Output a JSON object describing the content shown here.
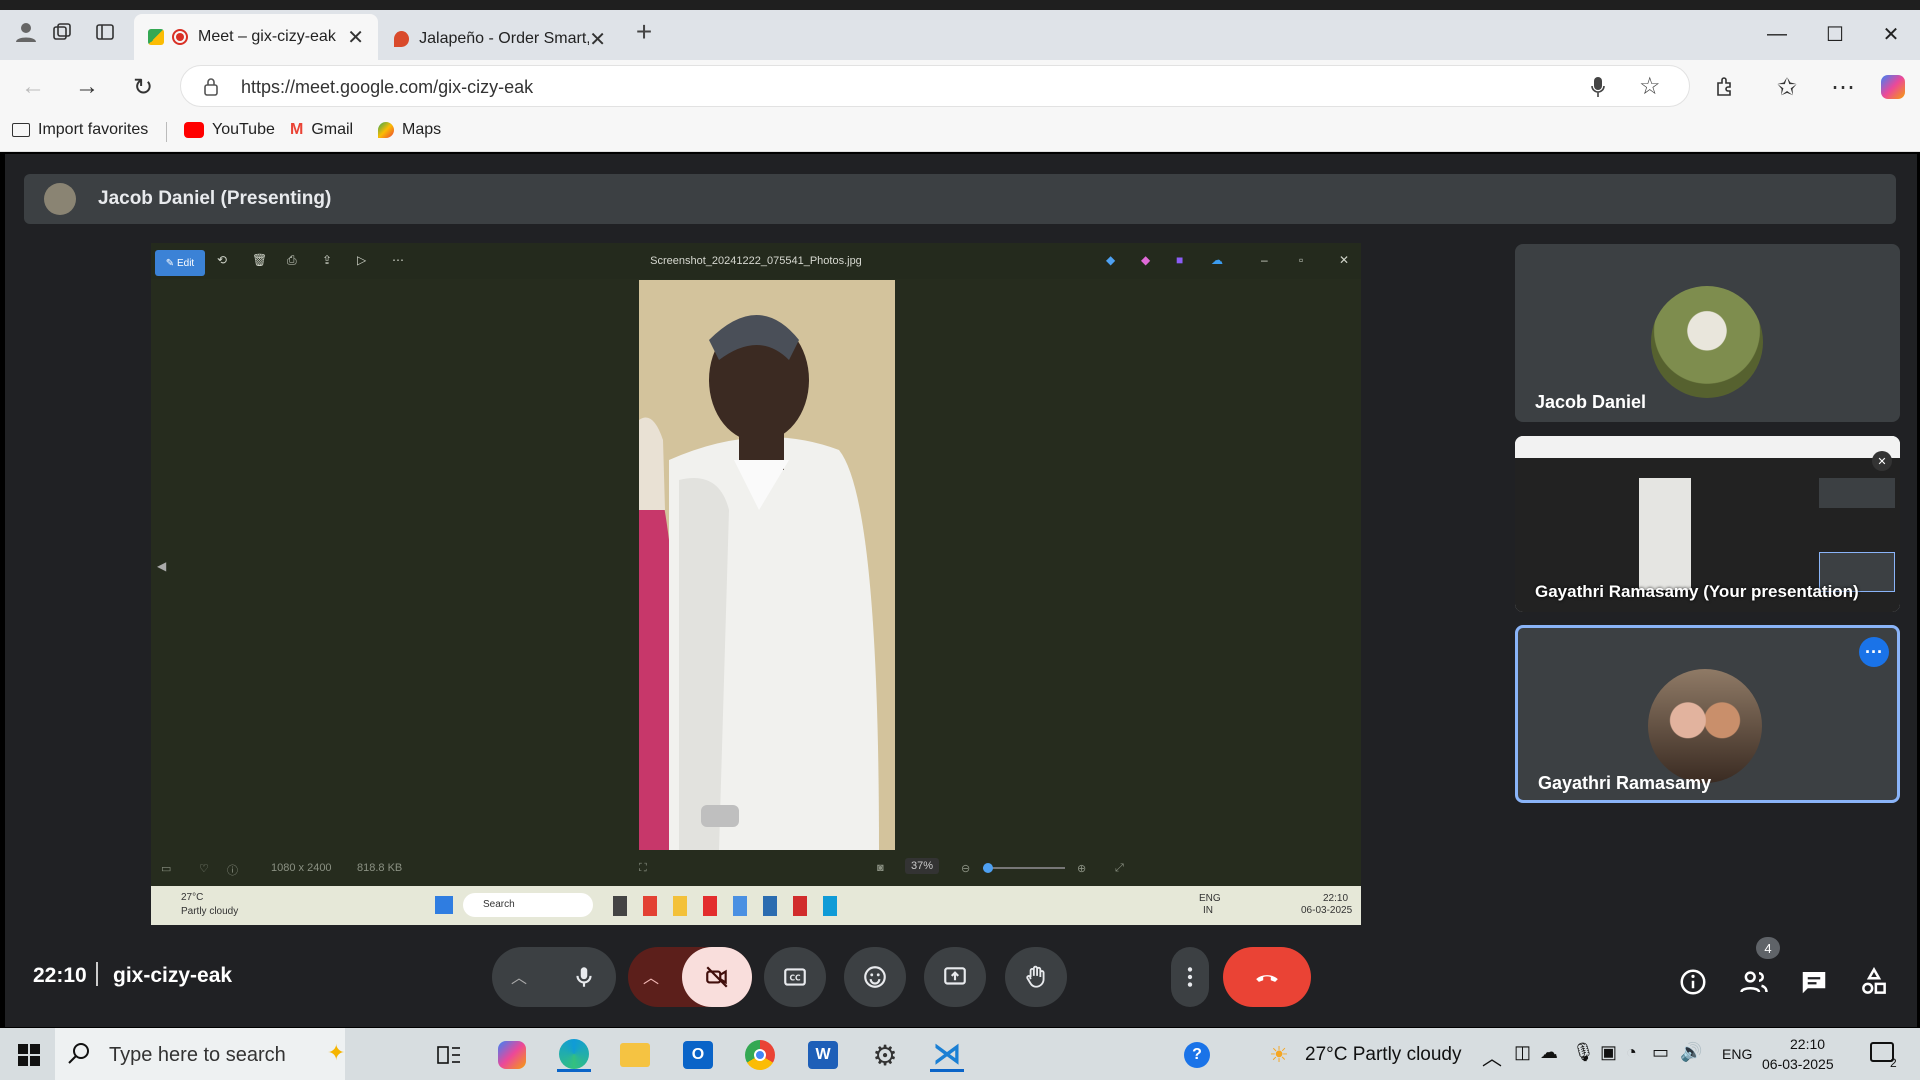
{
  "browser": {
    "tabs": [
      {
        "label": "Meet – gix-cizy-eak",
        "active": true
      },
      {
        "label": "Jalapeño - Order Smart, Eat Healt",
        "active": false
      }
    ],
    "url": "https://meet.google.com/gix-cizy-eak",
    "bookmarks": [
      "Import favorites",
      "YouTube",
      "Gmail",
      "Maps"
    ]
  },
  "meet": {
    "presenter_label": "Jacob Daniel (Presenting)",
    "time": "22:10",
    "meeting_code": "gix-cizy-eak",
    "people_count": "4",
    "participants": [
      {
        "name": "Jacob Daniel"
      },
      {
        "name": "Gayathri Ramasamy (Your presentation)"
      },
      {
        "name": "Gayathri Ramasamy"
      }
    ]
  },
  "shared_screen": {
    "edit_label": "Edit",
    "file_name": "Screenshot_20241222_075541_Photos.jpg",
    "dimensions": "1080 x 2400",
    "file_size": "818.8 KB",
    "zoom": "37%",
    "weather_temp": "27°C",
    "weather_desc": "Partly cloudy",
    "search_label": "Search",
    "lang": "ENG",
    "region": "IN",
    "clock_time": "22:10",
    "clock_date": "06-03-2025"
  },
  "taskbar": {
    "search_placeholder": "Type here to search",
    "weather": "27°C  Partly cloudy",
    "lang": "ENG",
    "time": "22:10",
    "date": "06-03-2025",
    "notification_count": "2"
  },
  "colors": {
    "meet_bg": "#202124",
    "tile_bg": "#3c4043",
    "end_call": "#ea4335",
    "camera_off": "#f9dedc",
    "accent_blue": "#8ab4f8"
  }
}
